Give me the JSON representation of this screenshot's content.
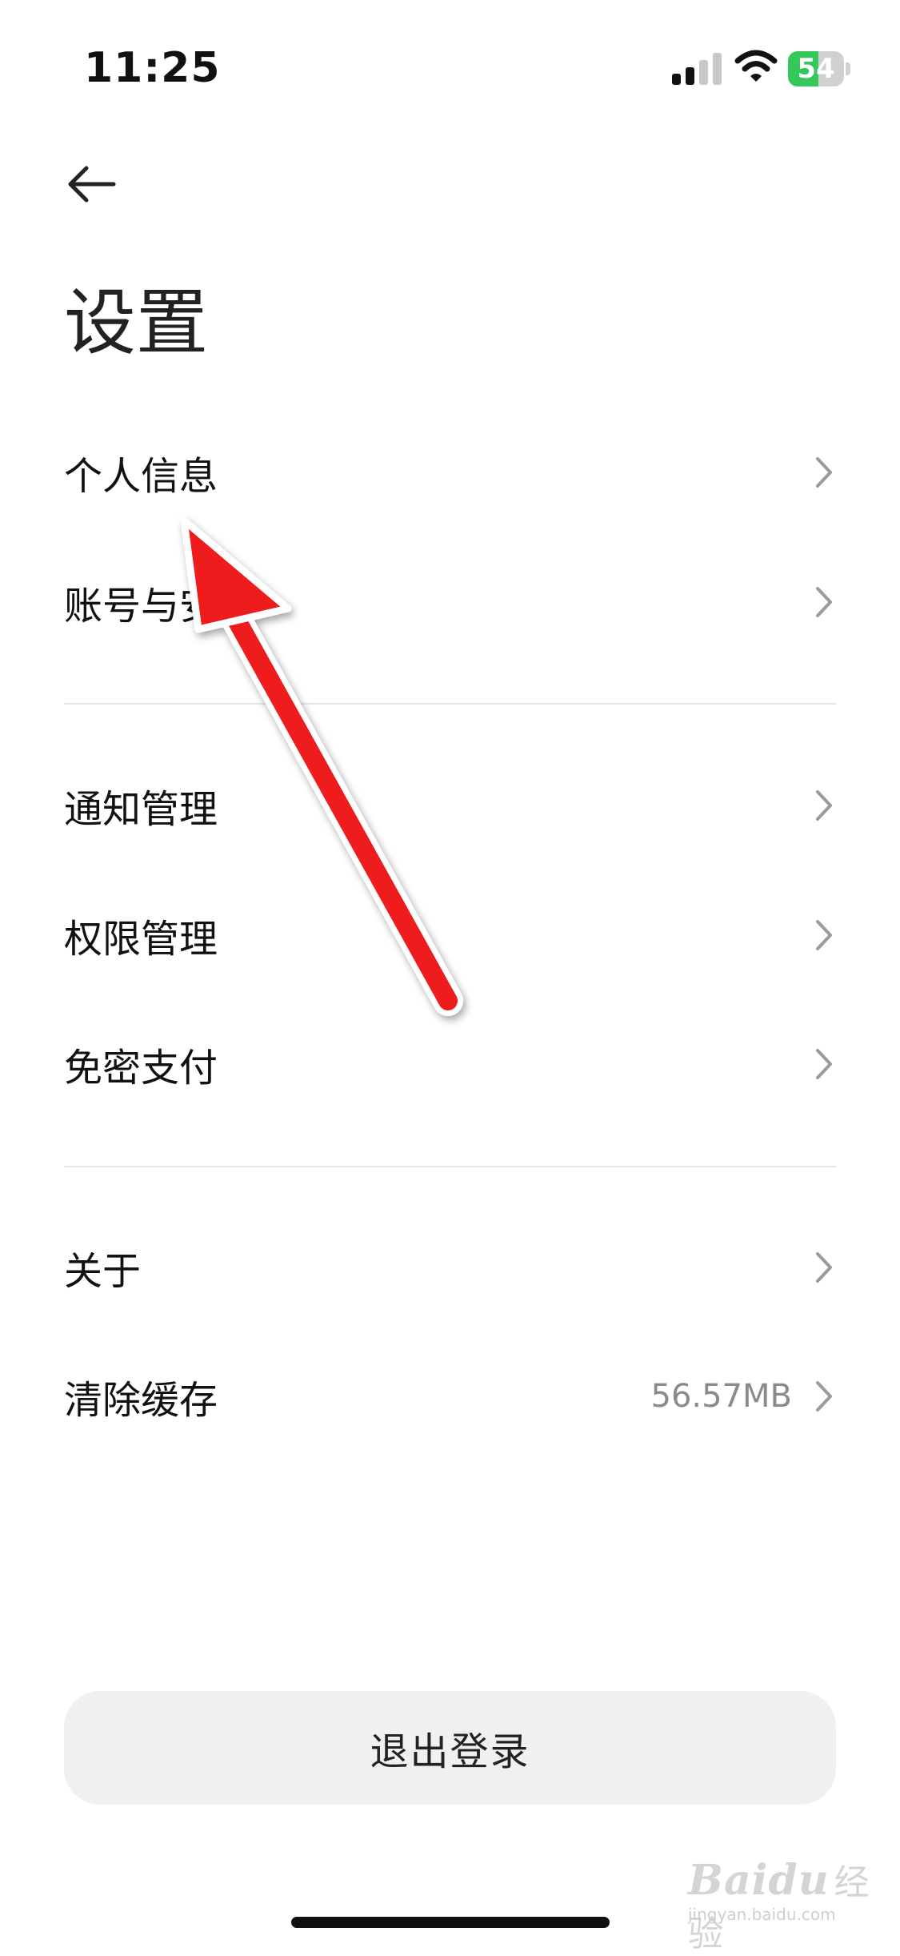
{
  "status_bar": {
    "time": "11:25",
    "battery_level": "54",
    "battery_fraction": 0.54,
    "colors": {
      "battery": "#34c759"
    }
  },
  "header": {
    "back_icon": "arrow-left-icon",
    "title": "设置"
  },
  "groups": [
    {
      "items": [
        {
          "label": "个人信息",
          "icon": "chevron-right-icon"
        },
        {
          "label": "账号与安全",
          "icon": "chevron-right-icon"
        }
      ]
    },
    {
      "items": [
        {
          "label": "通知管理",
          "icon": "chevron-right-icon"
        },
        {
          "label": "权限管理",
          "icon": "chevron-right-icon"
        },
        {
          "label": "免密支付",
          "icon": "chevron-right-icon"
        }
      ]
    },
    {
      "items": [
        {
          "label": "关于",
          "icon": "chevron-right-icon"
        },
        {
          "label": "清除缓存",
          "value": "56.57MB",
          "icon": "chevron-right-icon"
        }
      ]
    }
  ],
  "logout_button": {
    "label": "退出登录"
  },
  "annotation": {
    "color": "#ee1c1c",
    "icon": "red-arrow-icon"
  },
  "watermark": {
    "logo": "Baidu",
    "suffix": "经验",
    "domain": "jingyan.baidu.com"
  }
}
